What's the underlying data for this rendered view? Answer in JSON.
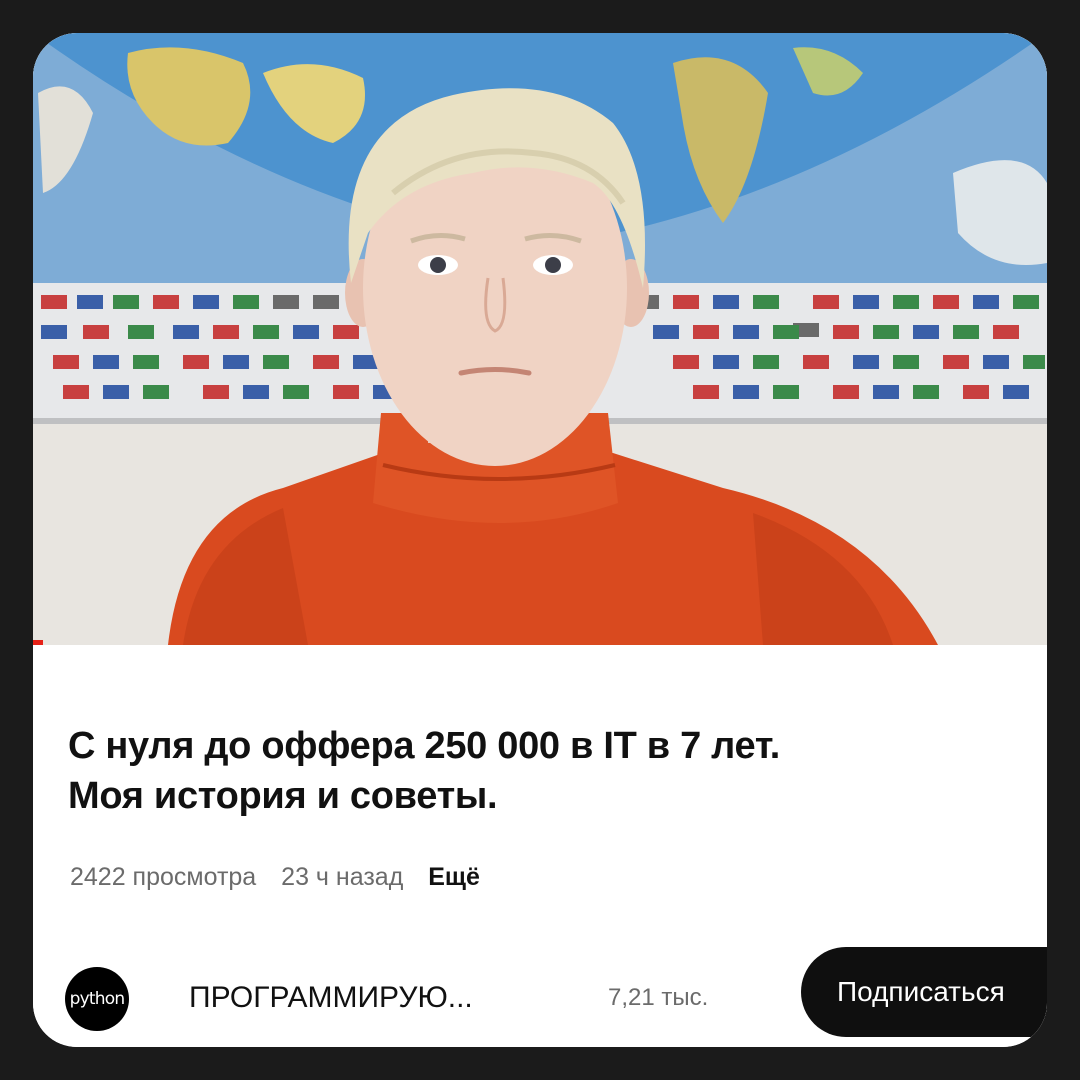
{
  "video": {
    "title_line1": "С нуля до оффера 250 000 в IT в 7 лет.",
    "title_line2": "Моя история и советы.",
    "views": "2422 просмотра",
    "published": "23 ч назад",
    "more_label": "Ещё",
    "progress_fraction": 0.01
  },
  "channel": {
    "avatar_text": "python",
    "name": "ПРОГРАММИРУЮ...",
    "subscribers": "7,21 тыс.",
    "subscribe_label": "Подписаться"
  },
  "colors": {
    "sweater": "#d94a1f",
    "ocean": "#4d93cf",
    "progress": "#e62117",
    "button": "#0f0f0f"
  }
}
